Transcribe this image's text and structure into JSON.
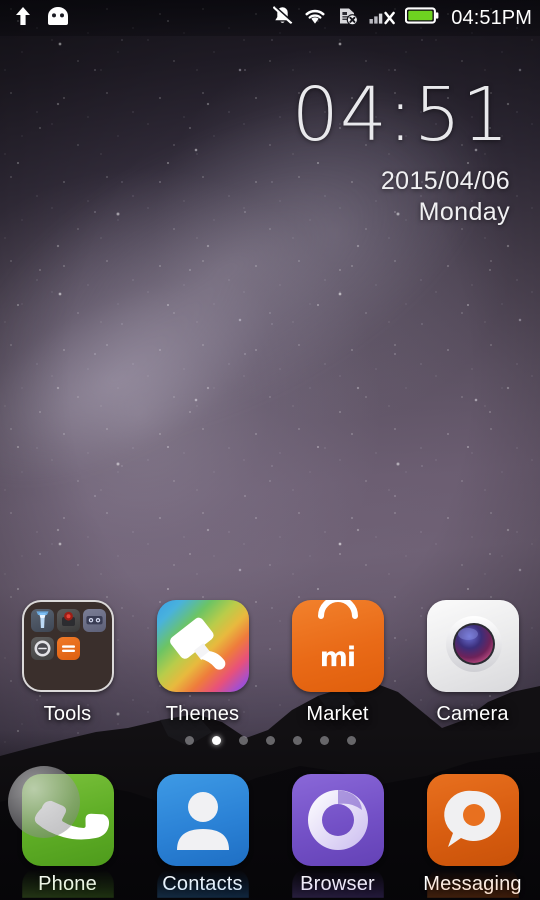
{
  "status_bar": {
    "left_icons": [
      {
        "name": "upload-arrow-icon",
        "label": "Upload"
      },
      {
        "name": "android-robot-icon",
        "label": "Android system"
      }
    ],
    "right_icons": [
      {
        "name": "vibrate-mute-icon",
        "label": "Silent / vibrate"
      },
      {
        "name": "wifi-icon",
        "label": "Wi-Fi connected"
      },
      {
        "name": "sim-card-missing-icon",
        "label": "No SIM card"
      },
      {
        "name": "signal-none-icon",
        "label": "No signal"
      },
      {
        "name": "battery-full-icon",
        "label": "Battery full"
      }
    ],
    "clock": "04:51PM",
    "battery_color": "#6ed320"
  },
  "clock_widget": {
    "time": "04:51",
    "date": "2015/04/06",
    "weekday": "Monday"
  },
  "home_screen": {
    "apps": [
      {
        "label": "Tools",
        "icon": "folder-icon",
        "type": "folder",
        "folder_items": [
          {
            "label": "Flashlight",
            "icon": "flashlight-icon"
          },
          {
            "label": "Recorder",
            "icon": "recorder-icon"
          },
          {
            "label": "Notes",
            "icon": "notes-icon"
          },
          {
            "label": "Compass",
            "icon": "compass-icon"
          },
          {
            "label": "Calculator",
            "icon": "calculator-icon"
          }
        ]
      },
      {
        "label": "Themes",
        "icon": "paintbrush-icon",
        "type": "app",
        "color": "#6cc464"
      },
      {
        "label": "Market",
        "icon": "shopping-bag-icon",
        "type": "app",
        "color": "#e96a17",
        "brand_text": "mi"
      },
      {
        "label": "Camera",
        "icon": "camera-lens-icon",
        "type": "app",
        "color": "#ececed"
      }
    ],
    "page_indicator": {
      "total": 7,
      "active_index": 1
    }
  },
  "dock": {
    "apps": [
      {
        "label": "Phone",
        "icon": "phone-handset-icon",
        "color": "#5fae26"
      },
      {
        "label": "Contacts",
        "icon": "person-icon",
        "color": "#2b82d6"
      },
      {
        "label": "Browser",
        "icon": "browser-spiral-icon",
        "color": "#7350c6"
      },
      {
        "label": "Messaging",
        "icon": "speech-bubble-icon",
        "color": "#d85d10"
      }
    ]
  },
  "overlay": {
    "floating_ball": {
      "name": "floating-assistant-ball",
      "visible": true
    }
  }
}
